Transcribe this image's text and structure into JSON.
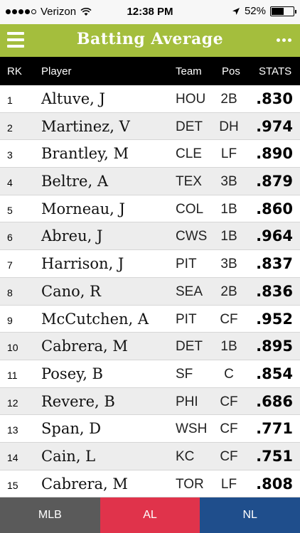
{
  "status_bar": {
    "carrier": "Verizon",
    "time": "12:38 PM",
    "battery": "52%",
    "battery_level": 0.52
  },
  "header": {
    "title": "Batting Average"
  },
  "columns": {
    "rk": "RK",
    "player": "Player",
    "team": "Team",
    "pos": "Pos",
    "stats": "STATS"
  },
  "rows": [
    {
      "rk": "1",
      "player": "Altuve, J",
      "team": "HOU",
      "pos": "2B",
      "stat": ".830"
    },
    {
      "rk": "2",
      "player": "Martinez, V",
      "team": "DET",
      "pos": "DH",
      "stat": ".974"
    },
    {
      "rk": "3",
      "player": "Brantley, M",
      "team": "CLE",
      "pos": "LF",
      "stat": ".890"
    },
    {
      "rk": "4",
      "player": "Beltre, A",
      "team": "TEX",
      "pos": "3B",
      "stat": ".879"
    },
    {
      "rk": "5",
      "player": "Morneau, J",
      "team": "COL",
      "pos": "1B",
      "stat": ".860"
    },
    {
      "rk": "6",
      "player": "Abreu, J",
      "team": "CWS",
      "pos": "1B",
      "stat": ".964"
    },
    {
      "rk": "7",
      "player": "Harrison, J",
      "team": "PIT",
      "pos": "3B",
      "stat": ".837"
    },
    {
      "rk": "8",
      "player": "Cano, R",
      "team": "SEA",
      "pos": "2B",
      "stat": ".836"
    },
    {
      "rk": "9",
      "player": "McCutchen, A",
      "team": "PIT",
      "pos": "CF",
      "stat": ".952"
    },
    {
      "rk": "10",
      "player": "Cabrera, M",
      "team": "DET",
      "pos": "1B",
      "stat": ".895"
    },
    {
      "rk": "11",
      "player": "Posey, B",
      "team": "SF",
      "pos": "C",
      "stat": ".854"
    },
    {
      "rk": "12",
      "player": "Revere, B",
      "team": "PHI",
      "pos": "CF",
      "stat": ".686"
    },
    {
      "rk": "13",
      "player": "Span, D",
      "team": "WSH",
      "pos": "CF",
      "stat": ".771"
    },
    {
      "rk": "14",
      "player": "Cain, L",
      "team": "KC",
      "pos": "CF",
      "stat": ".751"
    },
    {
      "rk": "15",
      "player": "Cabrera, M",
      "team": "TOR",
      "pos": "LF",
      "stat": ".808"
    }
  ],
  "tabs": [
    {
      "label": "MLB",
      "color": "#5a5a5a"
    },
    {
      "label": "AL",
      "color": "#e0334b"
    },
    {
      "label": "NL",
      "color": "#1f4e8c"
    }
  ],
  "colors": {
    "header": "#a4be3d",
    "column_header": "#000000",
    "alt_row": "#ededed"
  }
}
